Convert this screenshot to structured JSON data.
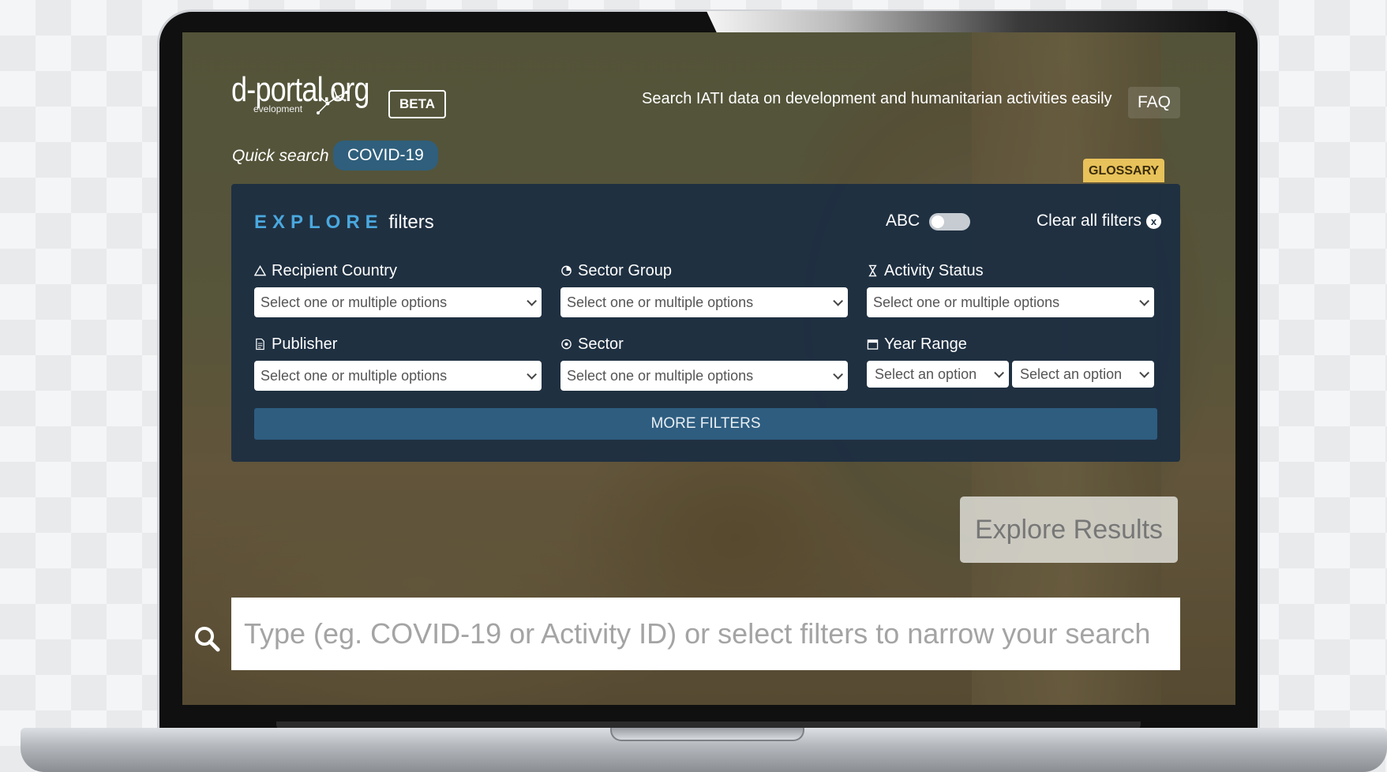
{
  "header": {
    "logo_main": "d-portal.org",
    "logo_sub": "evelopment",
    "beta": "BETA",
    "tagline": "Search IATI data on development and humanitarian activities easily",
    "faq": "FAQ"
  },
  "quick_search": {
    "label": "Quick search",
    "chip": "COVID-19"
  },
  "glossary": "GLOSSARY",
  "explore": {
    "title_strong": "EXPLORE",
    "title_rest": "filters",
    "abc_label": "ABC",
    "abc_toggle_on": false,
    "clear_all": "Clear all filters",
    "clear_icon": "x",
    "filters": [
      {
        "label": "Recipient Country",
        "icon": "triangle-icon",
        "placeholder": "Select one or multiple options"
      },
      {
        "label": "Sector Group",
        "icon": "pie-chart-icon",
        "placeholder": "Select one or multiple options"
      },
      {
        "label": "Activity Status",
        "icon": "hourglass-icon",
        "placeholder": "Select one or multiple options"
      },
      {
        "label": "Publisher",
        "icon": "document-icon",
        "placeholder": "Select one or multiple options"
      },
      {
        "label": "Sector",
        "icon": "target-icon",
        "placeholder": "Select one or multiple options"
      },
      {
        "label": "Year Range",
        "icon": "calendar-icon",
        "from_placeholder": "Select an option",
        "to_placeholder": "Select an option"
      }
    ],
    "more_filters": "MORE FILTERS"
  },
  "explore_results": "Explore Results",
  "search": {
    "placeholder": "Type (eg. COVID-19 or Activity ID) or select filters to narrow your search",
    "icon": "search-icon"
  },
  "colors": {
    "accent_blue": "#4aa8de",
    "panel": "#1c2e42",
    "glossary": "#e8c25a",
    "more_filters": "#2e5d80"
  }
}
